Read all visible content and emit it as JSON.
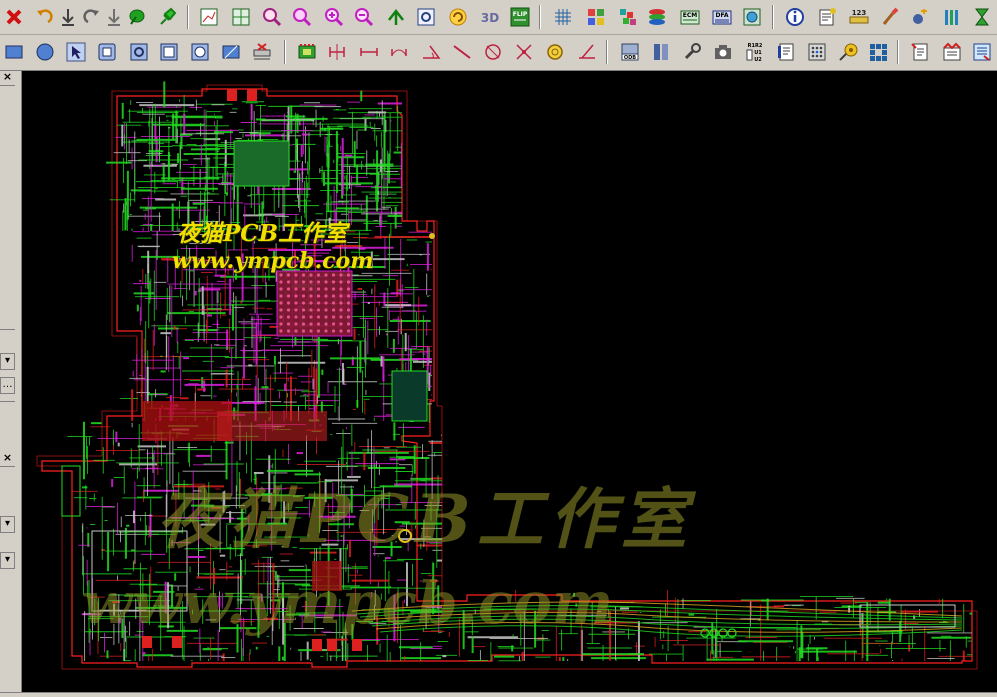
{
  "toolbar_top": {
    "buttons": [
      {
        "icon": "close-red-x-icon"
      },
      {
        "icon": "undo-icon"
      },
      {
        "icon": "download-icon"
      },
      {
        "icon": "redo-icon"
      },
      {
        "icon": "download-alt-icon"
      },
      {
        "icon": "leaf-icon"
      },
      {
        "icon": "pin-icon"
      },
      {
        "icon": "zoom-window-icon"
      },
      {
        "icon": "zoom-fit-icon"
      },
      {
        "icon": "zoom-previous-icon"
      },
      {
        "icon": "zoom-selection-icon"
      },
      {
        "icon": "zoom-in-icon"
      },
      {
        "icon": "zoom-out-icon"
      },
      {
        "icon": "pan-icon"
      },
      {
        "icon": "zoom-extents-icon"
      },
      {
        "icon": "refresh-icon"
      },
      {
        "icon": "view-3d-icon"
      },
      {
        "icon": "flip-board-icon"
      },
      {
        "icon": "grid-icon"
      },
      {
        "icon": "color-palette-icon"
      },
      {
        "icon": "layers-icon"
      },
      {
        "icon": "layer-stack-icon"
      },
      {
        "icon": "ecm-icon"
      },
      {
        "icon": "dfa-icon"
      },
      {
        "icon": "board-globe-icon"
      },
      {
        "icon": "info-icon"
      },
      {
        "icon": "properties-icon"
      },
      {
        "icon": "measure-icon"
      },
      {
        "icon": "brush-icon"
      },
      {
        "icon": "highlight-icon"
      },
      {
        "icon": "bars-icon"
      },
      {
        "icon": "hourglass-icon"
      }
    ],
    "labels": {
      "view3d": "3D",
      "flip": "FLIP",
      "ecm": "ECM",
      "dfa": "DFA",
      "measure": "123"
    }
  },
  "toolbar_bottom": {
    "buttons": [
      {
        "icon": "rectangle-icon"
      },
      {
        "icon": "circle-icon"
      },
      {
        "icon": "select-arrow-icon"
      },
      {
        "icon": "rounded-rect-icon"
      },
      {
        "icon": "rotate-shape-icon"
      },
      {
        "icon": "square-icon"
      },
      {
        "icon": "octagon-icon"
      },
      {
        "icon": "slot-icon"
      },
      {
        "icon": "delete-shape-icon"
      },
      {
        "icon": "component-icon"
      },
      {
        "icon": "dimension-vertical-icon"
      },
      {
        "icon": "dimension-horizontal-icon"
      },
      {
        "icon": "dimension-arc-icon"
      },
      {
        "icon": "angle-icon"
      },
      {
        "icon": "line-icon"
      },
      {
        "icon": "diameter-icon"
      },
      {
        "icon": "cross-icon"
      },
      {
        "icon": "coin-icon"
      },
      {
        "icon": "check-angle-icon"
      },
      {
        "icon": "odb-icon"
      },
      {
        "icon": "book-icon"
      },
      {
        "icon": "wrench-icon"
      },
      {
        "icon": "camera-icon"
      },
      {
        "icon": "netlist-compare-icon"
      },
      {
        "icon": "report-icon"
      },
      {
        "icon": "bga-icon"
      },
      {
        "icon": "test-point-icon"
      },
      {
        "icon": "pad-array-icon"
      },
      {
        "icon": "notes-icon"
      },
      {
        "icon": "notes-red-icon"
      },
      {
        "icon": "export-book-icon"
      }
    ],
    "labels": {
      "odb": "ODB",
      "netcompare_top": "R1R2",
      "netcompare_mid": "U1",
      "netcompare_bot": "U2"
    }
  },
  "left_panel": {
    "close1": "×",
    "close2": "×",
    "dropdown": "▾",
    "more": "…"
  },
  "canvas": {
    "background": "#000000",
    "watermark_small_cn": "夜猫PCB工作室",
    "watermark_small_url": "www.ympcb.com",
    "watermark_large_cn": "夜猫PCB工作室",
    "watermark_large_url": "www.ympcb.com"
  },
  "colors": {
    "outline": "#ff2020",
    "trace_green": "#22dd22",
    "trace_magenta": "#e020e0",
    "trace_white": "#c8c8c8",
    "pad_red": "#dd2020",
    "watermark": "#f0e000"
  }
}
